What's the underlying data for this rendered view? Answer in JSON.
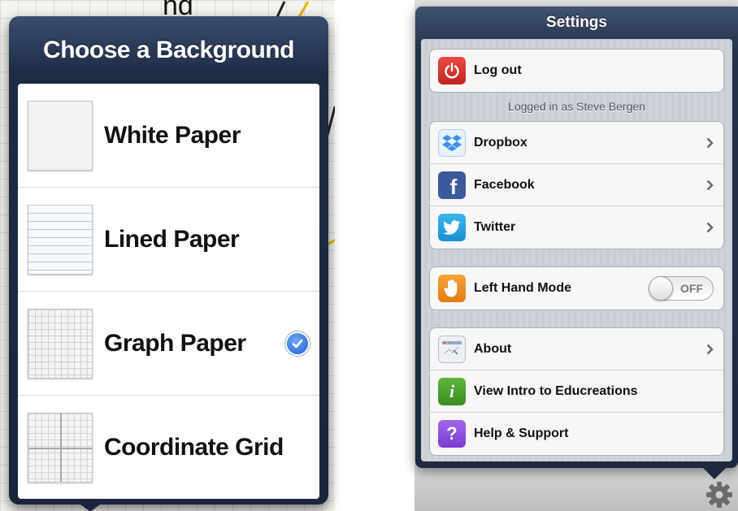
{
  "left_panel": {
    "background_text": "nd",
    "title": "Choose a Background",
    "options": [
      {
        "label": "White Paper",
        "icon": "white-paper-thumbnail",
        "selected": false
      },
      {
        "label": "Lined Paper",
        "icon": "lined-paper-thumbnail",
        "selected": false
      },
      {
        "label": "Graph Paper",
        "icon": "graph-paper-thumbnail",
        "selected": true
      },
      {
        "label": "Coordinate Grid",
        "icon": "coordinate-grid-thumbnail",
        "selected": false
      }
    ],
    "accent_color": "#2461d4"
  },
  "right_panel": {
    "title": "Settings",
    "logout": {
      "label": "Log out",
      "icon": "power-icon",
      "icon_color": "#d9322b"
    },
    "logged_in_caption": "Logged in as Steve Bergen",
    "services": [
      {
        "label": "Dropbox",
        "icon": "dropbox-icon",
        "icon_color": "#e8f2fc"
      },
      {
        "label": "Facebook",
        "icon": "facebook-icon",
        "icon_color": "#3b5a9a"
      },
      {
        "label": "Twitter",
        "icon": "twitter-icon",
        "icon_color": "#1fa0e0"
      }
    ],
    "left_hand_mode": {
      "label": "Left Hand Mode",
      "icon": "hand-icon",
      "icon_color": "#f08a1c",
      "toggle_value": "OFF",
      "enabled": false
    },
    "info": [
      {
        "label": "About",
        "icon": "about-icon",
        "has_chevron": true
      },
      {
        "label": "View Intro to Educreations",
        "icon": "info-icon",
        "icon_color": "#4a9f2a",
        "has_chevron": false
      },
      {
        "label": "Help & Support",
        "icon": "help-icon",
        "icon_color": "#8a48d8",
        "has_chevron": false
      }
    ],
    "gear_icon": "gear-icon"
  }
}
